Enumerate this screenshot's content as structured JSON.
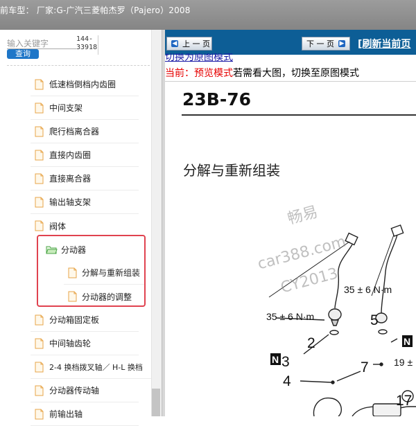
{
  "window": {
    "title": "前车型： 厂家:G-广汽三菱帕杰罗（Pajero）2008"
  },
  "search": {
    "placeholder": "输入关键字",
    "button_label": "查询",
    "page_range": "144-33918"
  },
  "tree": {
    "items": [
      {
        "label": "低速档倒档内齿圈"
      },
      {
        "label": "中间支架"
      },
      {
        "label": "爬行档离合器"
      },
      {
        "label": "直接内齿圈"
      },
      {
        "label": "直接离合器"
      },
      {
        "label": "输出轴支架"
      },
      {
        "label": "阀体"
      }
    ],
    "folder": {
      "label": "分动器",
      "children": [
        {
          "label": "分解与重新组装"
        },
        {
          "label": "分动器的调整"
        }
      ]
    },
    "items_after": [
      {
        "label": "分动箱固定板"
      },
      {
        "label": "中间轴齿轮"
      },
      {
        "label": "2-4 换档拨叉轴／ H-L 换档"
      },
      {
        "label": "分动器传动轴"
      },
      {
        "label": "前输出轴"
      }
    ]
  },
  "nav": {
    "prev_label": "上 一 页",
    "next_label": "下 一 页",
    "refresh_label": "[刷新当前页"
  },
  "viewer": {
    "switch_link": "切换为原图模式",
    "mode_prefix": "当前：",
    "mode_name": "预览模式",
    "mode_hint": "若需看大图，切换至原图模式",
    "page_code": "23B-76",
    "section_title": "分解与重新组装",
    "torque_1": "35 ± 6 N·m",
    "torque_2": "35 ± 6 N·m",
    "torque_3": "19 ±",
    "callouts": [
      "2",
      "3",
      "4",
      "5",
      "7",
      "17"
    ],
    "watermark_1": "畅易",
    "watermark_2": "car388.com",
    "watermark_3": "CY2013"
  },
  "colors": {
    "nav_bar": "#0d5e96",
    "highlight": "#e0424f",
    "search_button": "#1e76c8",
    "mode_red": "#e60000"
  }
}
